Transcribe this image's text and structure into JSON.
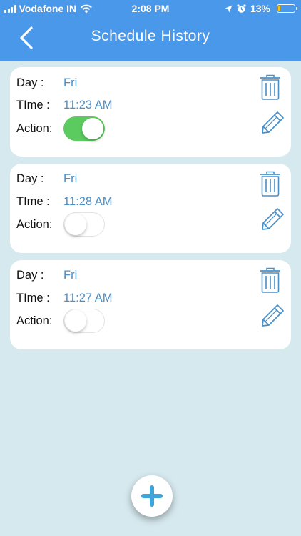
{
  "status_bar": {
    "carrier": "Vodafone IN",
    "time": "2:08 PM",
    "battery": "13%",
    "battery_level_percent": 13
  },
  "nav": {
    "title": "Schedule History",
    "back_icon": "chevron-left-icon"
  },
  "labels": {
    "day": "Day :",
    "time": "TIme :",
    "action": "Action:"
  },
  "schedules": [
    {
      "day": "Fri",
      "time": "11:23 AM",
      "action_on": true
    },
    {
      "day": "Fri",
      "time": "11:28 AM",
      "action_on": false
    },
    {
      "day": "Fri",
      "time": "11:27 AM",
      "action_on": false
    }
  ],
  "icons": {
    "delete": "trash-icon",
    "edit": "pencil-icon",
    "add": "plus-icon"
  },
  "colors": {
    "header": "#4a98ea",
    "background": "#d6e9ee",
    "accent": "#4a8fc8",
    "toggle_on": "#5ccb5f",
    "fab_plus": "#3fa5d9",
    "battery_fill": "#f7c30e"
  }
}
